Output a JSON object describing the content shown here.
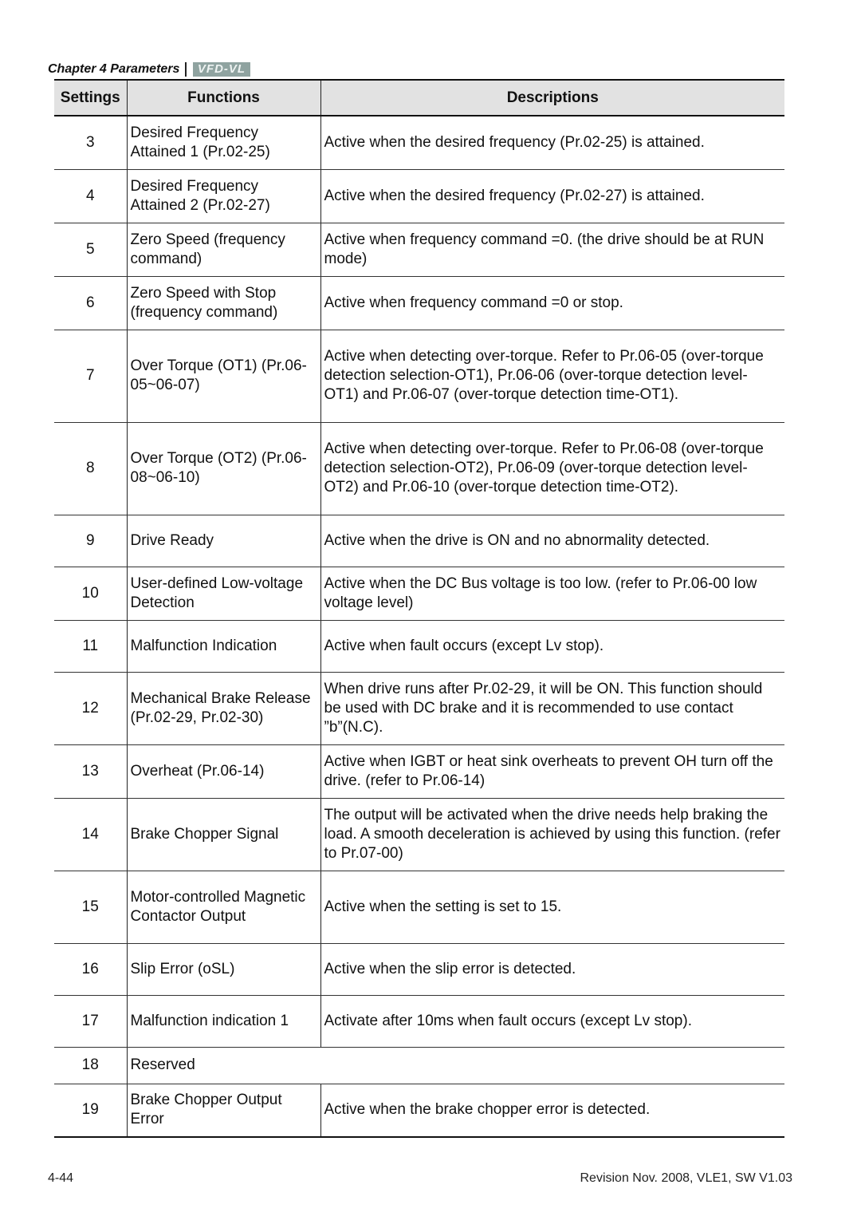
{
  "header": {
    "chapter": "Chapter 4 Parameters",
    "logo_text": "VFD-VL"
  },
  "table": {
    "columns": [
      "Settings",
      "Functions",
      "Descriptions"
    ],
    "rows": [
      {
        "setting": "3",
        "function": "Desired Frequency Attained 1 (Pr.02-25)",
        "description": "Active when the desired frequency (Pr.02-25) is attained."
      },
      {
        "setting": "4",
        "function": "Desired Frequency Attained 2 (Pr.02-27)",
        "description": "Active when the desired frequency (Pr.02-27) is attained."
      },
      {
        "setting": "5",
        "function": "Zero Speed (frequency command)",
        "description": "Active when frequency command =0. (the drive should be at RUN mode)"
      },
      {
        "setting": "6",
        "function": "Zero Speed with Stop (frequency command)",
        "description": "Active when frequency command =0 or stop."
      },
      {
        "setting": "7",
        "function": "Over Torque (OT1) (Pr.06-05~06-07)",
        "description": "Active when detecting over-torque. Refer to Pr.06-05 (over-torque detection selection-OT1), Pr.06-06 (over-torque detection level-OT1) and Pr.06-07 (over-torque detection time-OT1)."
      },
      {
        "setting": "8",
        "function": "Over Torque (OT2) (Pr.06-08~06-10)",
        "description": "Active when detecting over-torque. Refer to Pr.06-08 (over-torque detection selection-OT2), Pr.06-09 (over-torque detection level-OT2) and Pr.06-10 (over-torque detection time-OT2)."
      },
      {
        "setting": "9",
        "function": "Drive Ready",
        "description": "Active when the drive is ON and no abnormality detected."
      },
      {
        "setting": "10",
        "function": "User-defined Low-voltage Detection",
        "description": "Active when the DC Bus voltage is too low. (refer to Pr.06-00 low voltage level)"
      },
      {
        "setting": "11",
        "function": "Malfunction Indication",
        "description": "Active when fault occurs (except Lv stop)."
      },
      {
        "setting": "12",
        "function": "Mechanical Brake Release (Pr.02-29, Pr.02-30)",
        "description": "When drive runs after Pr.02-29, it will be ON. This function should be used with DC brake and it is recommended to use contact ”b”(N.C)."
      },
      {
        "setting": "13",
        "function": "Overheat (Pr.06-14)",
        "description": "Active when IGBT or heat sink overheats to prevent OH turn off the drive. (refer to Pr.06-14)"
      },
      {
        "setting": "14",
        "function": "Brake Chopper Signal",
        "description": "The output will be activated when the drive needs help braking the load. A smooth deceleration is achieved by using this function. (refer to Pr.07-00)"
      },
      {
        "setting": "15",
        "function": "Motor-controlled Magnetic Contactor Output",
        "description": "Active when the setting is set to 15."
      },
      {
        "setting": "16",
        "function": "Slip Error (oSL)",
        "description": "Active when the slip error is detected."
      },
      {
        "setting": "17",
        "function": "Malfunction indication 1",
        "description": "Activate after 10ms when fault occurs (except Lv stop)."
      },
      {
        "setting": "18",
        "function": "Reserved",
        "description": null
      },
      {
        "setting": "19",
        "function": "Brake Chopper Output Error",
        "description": "Active when the brake chopper error is detected."
      }
    ]
  },
  "footer": {
    "page_number": "4-44",
    "revision": "Revision Nov. 2008, VLE1, SW V1.03"
  }
}
